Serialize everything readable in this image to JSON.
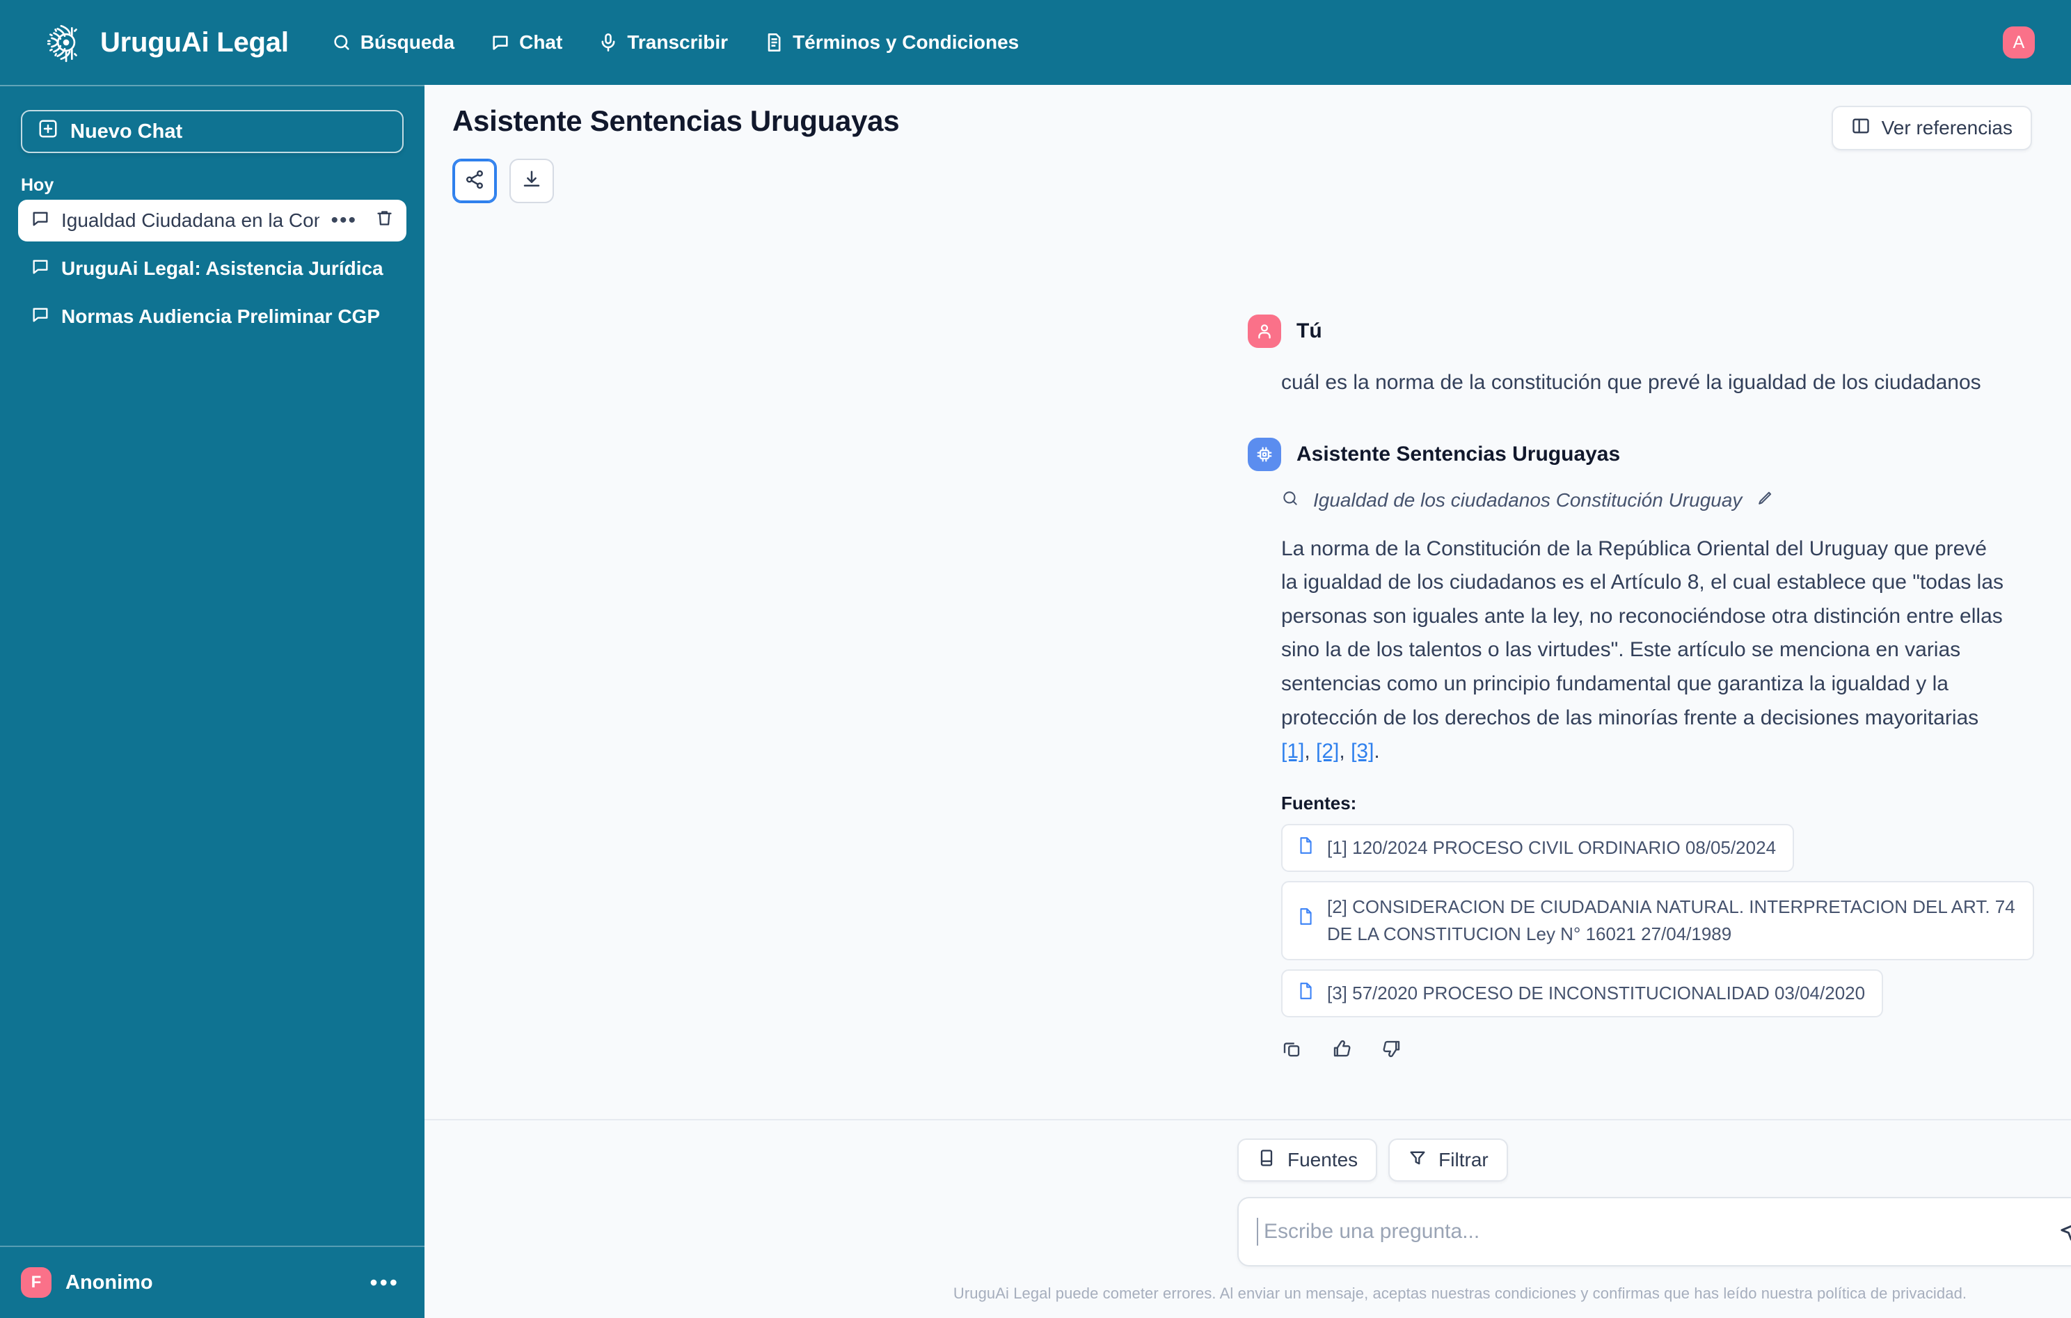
{
  "topnav": {
    "brand": "UruguAi Legal",
    "logo_icon": "tribal-circle-logo",
    "links": [
      {
        "label": "Búsqueda",
        "icon": "search-icon"
      },
      {
        "label": "Chat",
        "icon": "chat-bubble-icon"
      },
      {
        "label": "Transcribir",
        "icon": "microphone-icon"
      },
      {
        "label": "Términos y Condiciones",
        "icon": "document-icon"
      }
    ],
    "avatar_initial": "A"
  },
  "sidebar": {
    "new_chat_label": "Nuevo Chat",
    "new_chat_icon": "plus-square-icon",
    "section_label": "Hoy",
    "chats": [
      {
        "label": "Igualdad Ciudadana en la Con",
        "icon": "chat-bubble-icon",
        "active": true
      },
      {
        "label": "UruguAi Legal: Asistencia Jurídica",
        "icon": "chat-bubble-icon",
        "active": false
      },
      {
        "label": "Normas Audiencia Preliminar CGP",
        "icon": "chat-bubble-icon",
        "active": false
      }
    ],
    "user": {
      "initial": "F",
      "name": "Anonimo",
      "menu_icon": "ellipsis-icon"
    }
  },
  "main": {
    "page_title": "Asistente Sentencias Uruguayas",
    "share_icon": "share-icon",
    "download_icon": "download-icon",
    "view_references_label": "Ver referencias",
    "view_references_icon": "panel-right-icon"
  },
  "conversation": {
    "user_message": {
      "author": "Tú",
      "avatar_icon": "person-icon",
      "text": "cuál es la norma de la constitución que prevé la igualdad de los ciudadanos"
    },
    "assistant_message": {
      "author": "Asistente Sentencias Uruguayas",
      "avatar_icon": "cpu-chip-icon",
      "refined_query": "Igualdad de los ciudadanos Constitución Uruguay",
      "refined_query_icon": "search-icon",
      "edit_icon": "pencil-icon",
      "answer_part_1": "La norma de la Constitución de la República Oriental del Uruguay que prevé la igualdad de los ciudadanos es el Artículo 8, el cual establece que \"todas las personas son iguales ante la ley, no reconociéndose otra distinción entre ellas sino la de los talentos o las virtudes\". Este artículo se menciona en varias sentencias como un principio fundamental que garantiza la igualdad y la protección de los derechos de las minorías frente a decisiones mayoritarias ",
      "citations": [
        "[1]",
        "[2]",
        "[3]"
      ],
      "answer_end": ".",
      "sources_label": "Fuentes:",
      "sources": [
        {
          "text": "[1] 120/2024 PROCESO CIVIL ORDINARIO 08/05/2024",
          "icon": "file-icon",
          "two_line": false
        },
        {
          "text": "[2] CONSIDERACION DE CIUDADANIA NATURAL. INTERPRETACION DEL ART. 74 DE LA CONSTITUCION Ley N° 16021 27/04/1989",
          "icon": "file-icon",
          "two_line": true
        },
        {
          "text": "[3] 57/2020 PROCESO DE INCONSTITUCIONALIDAD 03/04/2020",
          "icon": "file-icon",
          "two_line": false
        }
      ],
      "actions": [
        {
          "name": "copy-button",
          "icon": "copy-icon"
        },
        {
          "name": "thumbs-up-button",
          "icon": "thumbs-up-icon"
        },
        {
          "name": "thumbs-down-button",
          "icon": "thumbs-down-icon"
        }
      ]
    }
  },
  "composer": {
    "sources_chip": {
      "label": "Fuentes",
      "icon": "book-icon"
    },
    "filter_chip": {
      "label": "Filtrar",
      "icon": "funnel-icon"
    },
    "placeholder": "Escribe una pregunta...",
    "send_icon": "send-icon",
    "disclaimer": "UruguAi Legal puede cometer errores. Al enviar un mensaje, aceptas nuestras condiciones y confirmas que has leído nuestra política de privacidad."
  },
  "colors": {
    "teal": "#0f7392",
    "background": "#f8fafc",
    "accent_blue": "#2f80ed",
    "pink": "#fa7189",
    "bot_blue": "#5b8def",
    "text_dark": "#11182c"
  }
}
